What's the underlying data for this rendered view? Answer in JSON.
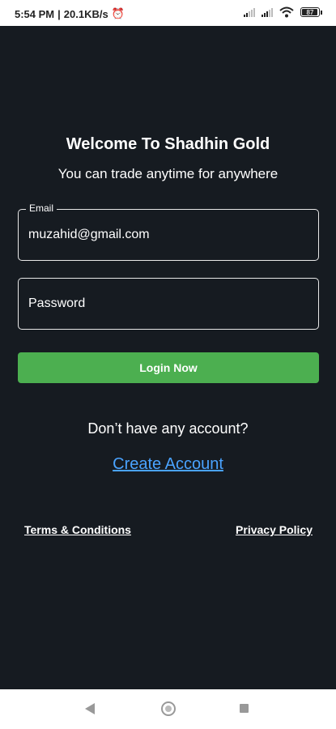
{
  "status_bar": {
    "time": "5:54 PM",
    "separator": "|",
    "network_speed": "20.1KB/s",
    "alarm_icon": "alarm-icon",
    "battery_level": "87",
    "battery_fraction": 0.87
  },
  "login": {
    "title": "Welcome To Shadhin Gold",
    "subtitle": "You can trade anytime for anywhere",
    "email_label": "Email",
    "email_value": "muzahid@gmail.com",
    "password_placeholder": "Password",
    "login_button": "Login Now",
    "no_account_text": "Don’t have any account?",
    "create_account": "Create Account"
  },
  "footer": {
    "terms": "Terms & Conditions",
    "privacy": "Privacy Policy"
  },
  "colors": {
    "background": "#161b21",
    "primary_button": "#4caf50",
    "link": "#4aa3ff"
  },
  "nav_bar": {
    "icons": [
      "back-icon",
      "home-icon",
      "recents-icon"
    ]
  }
}
